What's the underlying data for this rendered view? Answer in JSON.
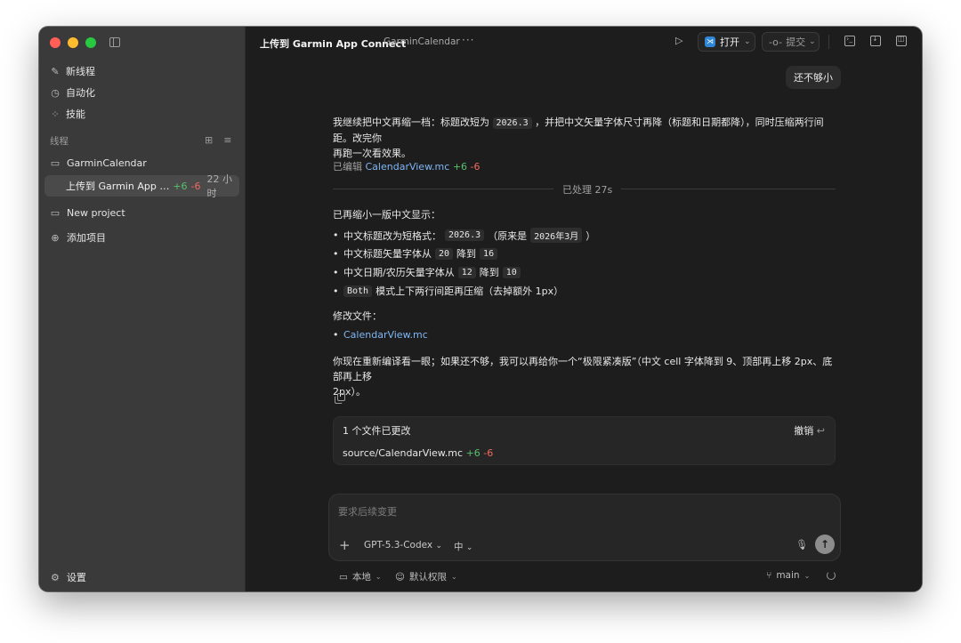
{
  "sidebar": {
    "nav": [
      {
        "label": "新线程",
        "icon": "compose-icon"
      },
      {
        "label": "自动化",
        "icon": "clock-icon"
      },
      {
        "label": "技能",
        "icon": "grid-icon"
      }
    ],
    "section_label": "线程",
    "projects": [
      {
        "label": "GarminCalendar",
        "icon": "folder-icon"
      },
      {
        "label": "New project",
        "icon": "folder-icon"
      },
      {
        "label": "添加项目",
        "icon": "folder-add-icon"
      }
    ],
    "active_thread": {
      "title": "上传到 Garmin App Connect",
      "added": "+6",
      "removed": "-6",
      "age": "22 小时"
    },
    "settings_label": "设置"
  },
  "topbar": {
    "title": "上传到 Garmin App Connect",
    "subtitle": "GarminCalendar",
    "more": "···",
    "open_label": "打开",
    "commit_label": "提交"
  },
  "conversation": {
    "user_message": "还不够小",
    "reply_line1": "我继续把中文再缩一档：标题改短为",
    "reply_code1": "2026.3",
    "reply_line1b": "，并把中文矢量字体尺寸再降（标题和日期都降），同时压缩两行间距。改完你",
    "reply_line2": "再跑一次看效果。",
    "edited_prefix": "已编辑",
    "edited_file": "CalendarView.mc",
    "edited_added": "+6",
    "edited_removed": "-6",
    "processed": "已处理 27s",
    "summary_heading": "已再缩小一版中文显示：",
    "bullets": [
      {
        "pre": "中文标题改为短格式：",
        "code": "2026.3",
        "mid": "（原来是",
        "code2": "2026年3月",
        "post": "）"
      },
      {
        "pre": "中文标题矢量字体从",
        "code": "20",
        "mid": "降到",
        "code2": "16",
        "post": ""
      },
      {
        "pre": "中文日期/农历矢量字体从",
        "code": "12",
        "mid": "降到",
        "code2": "10",
        "post": ""
      },
      {
        "pre": "",
        "code": "Both",
        "mid": "模式上下两行间距再压缩（去掉额外 1px）",
        "code2": "",
        "post": ""
      }
    ],
    "files_heading": "修改文件：",
    "files": [
      "CalendarView.mc"
    ],
    "closing_line1": "你现在重新编译看一眼；如果还不够，我可以再给你一个“极限紧凑版”（中文 cell 字体降到 9、顶部再上移 2px、底部再上移",
    "closing_line2": "2px）。"
  },
  "changes": {
    "header": "1 个文件已更改",
    "undo_label": "撤销",
    "file_path": "source/CalendarView.mc",
    "added": "+6",
    "removed": "-6"
  },
  "composer": {
    "placeholder": "要求后续变更",
    "model": "GPT-5.3-Codex",
    "effort": "中"
  },
  "bottombar": {
    "env": "本地",
    "permissions": "默认权限",
    "branch": "main"
  },
  "colors": {
    "added": "#58c06b",
    "removed": "#f06a5e",
    "link": "#7fb6f5",
    "sidebar_bg": "#3a3a3a",
    "main_bg": "#1d1d1d"
  }
}
